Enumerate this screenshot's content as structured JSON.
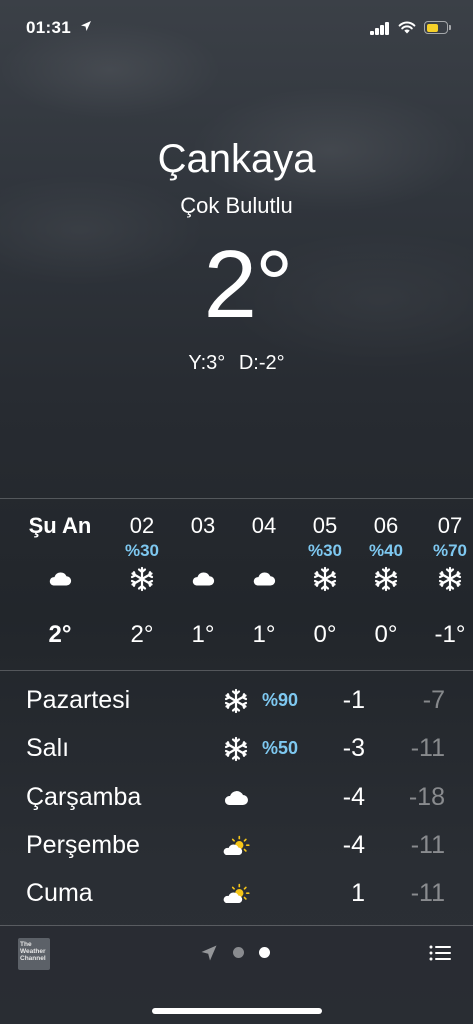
{
  "status_bar": {
    "time": "01:31",
    "battery_level_pct": 45,
    "battery_color": "#f5d029"
  },
  "header": {
    "city": "Çankaya",
    "condition": "Çok Bulutlu",
    "temperature": "2°",
    "high": "Y:3°",
    "low": "D:-2°"
  },
  "hourly": [
    {
      "hour": "Şu An",
      "pct": "",
      "icon": "cloud-icon",
      "temp": "2°"
    },
    {
      "hour": "02",
      "pct": "%30",
      "icon": "snowflake-icon",
      "temp": "2°"
    },
    {
      "hour": "03",
      "pct": "",
      "icon": "cloud-icon",
      "temp": "1°"
    },
    {
      "hour": "04",
      "pct": "",
      "icon": "cloud-icon",
      "temp": "1°"
    },
    {
      "hour": "05",
      "pct": "%30",
      "icon": "snowflake-icon",
      "temp": "0°"
    },
    {
      "hour": "06",
      "pct": "%40",
      "icon": "snowflake-icon",
      "temp": "0°"
    },
    {
      "hour": "07",
      "pct": "%70",
      "icon": "snowflake-icon",
      "temp": "-1°"
    }
  ],
  "daily": [
    {
      "day": "Pazartesi",
      "icon": "snowflake-icon",
      "pct": "%90",
      "high": "-1",
      "low": "-7"
    },
    {
      "day": "Salı",
      "icon": "snowflake-icon",
      "pct": "%50",
      "high": "-3",
      "low": "-11"
    },
    {
      "day": "Çarşamba",
      "icon": "cloud-icon",
      "pct": "",
      "high": "-4",
      "low": "-18"
    },
    {
      "day": "Perşembe",
      "icon": "partly-sunny-icon",
      "pct": "",
      "high": "-4",
      "low": "-11"
    },
    {
      "day": "Cuma",
      "icon": "partly-sunny-icon",
      "pct": "",
      "high": "1",
      "low": "-11"
    }
  ],
  "bottom_bar": {
    "logo_text": "The Weather Channel",
    "page_count": 2,
    "active_page": 2
  },
  "colors": {
    "precip_blue": "#7ec8f0",
    "sun_yellow": "#f5c518"
  }
}
